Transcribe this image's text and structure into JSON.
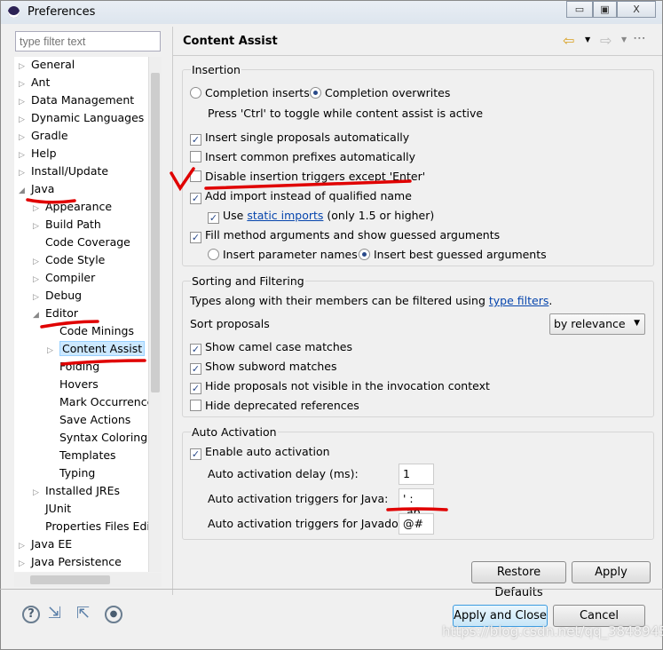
{
  "window": {
    "title": "Preferences",
    "minimize": "▭",
    "maximize": "▣",
    "close": "X"
  },
  "filter": {
    "placeholder": "type filter text"
  },
  "tree": [
    {
      "label": "General",
      "level": 0,
      "tw": "▷"
    },
    {
      "label": "Ant",
      "level": 0,
      "tw": "▷"
    },
    {
      "label": "Data Management",
      "level": 0,
      "tw": "▷"
    },
    {
      "label": "Dynamic Languages",
      "level": 0,
      "tw": "▷"
    },
    {
      "label": "Gradle",
      "level": 0,
      "tw": "▷"
    },
    {
      "label": "Help",
      "level": 0,
      "tw": "▷"
    },
    {
      "label": "Install/Update",
      "level": 0,
      "tw": "▷"
    },
    {
      "label": "Java",
      "level": 0,
      "tw": "◢"
    },
    {
      "label": "Appearance",
      "level": 1,
      "tw": "▷"
    },
    {
      "label": "Build Path",
      "level": 1,
      "tw": "▷"
    },
    {
      "label": "Code Coverage",
      "level": 1,
      "tw": ""
    },
    {
      "label": "Code Style",
      "level": 1,
      "tw": "▷"
    },
    {
      "label": "Compiler",
      "level": 1,
      "tw": "▷"
    },
    {
      "label": "Debug",
      "level": 1,
      "tw": "▷"
    },
    {
      "label": "Editor",
      "level": 1,
      "tw": "◢"
    },
    {
      "label": "Code Minings",
      "level": 2,
      "tw": ""
    },
    {
      "label": "Content Assist",
      "level": 2,
      "tw": "▷",
      "selected": true
    },
    {
      "label": "Folding",
      "level": 2,
      "tw": ""
    },
    {
      "label": "Hovers",
      "level": 2,
      "tw": ""
    },
    {
      "label": "Mark Occurrences",
      "level": 2,
      "tw": ""
    },
    {
      "label": "Save Actions",
      "level": 2,
      "tw": ""
    },
    {
      "label": "Syntax Coloring",
      "level": 2,
      "tw": ""
    },
    {
      "label": "Templates",
      "level": 2,
      "tw": ""
    },
    {
      "label": "Typing",
      "level": 2,
      "tw": ""
    },
    {
      "label": "Installed JREs",
      "level": 1,
      "tw": "▷"
    },
    {
      "label": "JUnit",
      "level": 1,
      "tw": ""
    },
    {
      "label": "Properties Files Editor",
      "level": 1,
      "tw": ""
    },
    {
      "label": "Java EE",
      "level": 0,
      "tw": "▷"
    },
    {
      "label": "Java Persistence",
      "level": 0,
      "tw": "▷"
    }
  ],
  "page": {
    "title": "Content Assist"
  },
  "insertion": {
    "label": "Insertion",
    "completion_inserts": "Completion inserts",
    "completion_overwrites": "Completion overwrites",
    "toggle_hint": "Press 'Ctrl' to toggle while content assist is active",
    "insert_single": "Insert single proposals automatically",
    "insert_common": "Insert common prefixes automatically",
    "disable_triggers": "Disable insertion triggers except 'Enter'",
    "add_import": "Add import instead of qualified name",
    "use": "Use",
    "static_imports": "static imports",
    "only15": "(only 1.5 or higher)",
    "fill_args": "Fill method arguments and show guessed arguments",
    "insert_param_names": "Insert parameter names",
    "insert_best_guessed": "Insert best guessed arguments"
  },
  "sorting": {
    "label": "Sorting and Filtering",
    "types_text": "Types along with their members can be filtered using",
    "type_filters": "type filters",
    "period": ".",
    "sort_proposals": "Sort proposals",
    "sort_value": "by relevance",
    "camel": "Show camel case matches",
    "subword": "Show subword matches",
    "hide_not_visible": "Hide proposals not visible in the invocation context",
    "hide_deprecated": "Hide deprecated references"
  },
  "auto": {
    "label": "Auto Activation",
    "enable": "Enable auto activation",
    "delay_label": "Auto activation delay (ms):",
    "delay_value": "1",
    "java_label": "Auto activation triggers for Java:",
    "java_value": "' : .ab",
    "javadoc_label": "Auto activation triggers for Javadoc:",
    "javadoc_value": "@#"
  },
  "buttons": {
    "restore": "Restore Defaults",
    "apply": "Apply",
    "apply_close": "Apply and Close",
    "cancel": "Cancel"
  },
  "watermark": "https://blog.csdn.net/qq_38489451",
  "colors": {
    "annotation": "#e00000",
    "link": "#0645ad",
    "selected": "#cce8ff"
  }
}
